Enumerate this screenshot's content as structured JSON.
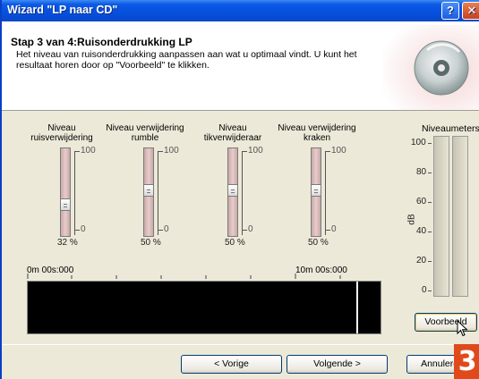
{
  "window": {
    "title": "Wizard \"LP naar CD\"",
    "help_glyph": "?",
    "close_glyph": "✕"
  },
  "header": {
    "step_title": "Stap 3 van 4:Ruisonderdrukking LP",
    "description": "Het niveau van ruisonderdrukking aanpassen aan wat u optimaal vindt. U kunt het resultaat horen door op \"Voorbeeld\" te klikken.",
    "icon": "cd-disc-icon"
  },
  "sliders": [
    {
      "label": "Niveau ruisverwijdering",
      "max": "100",
      "min": "0",
      "value_text": "32 %",
      "value": 32
    },
    {
      "label": "Niveau verwijdering rumble",
      "max": "100",
      "min": "0",
      "value_text": "50 %",
      "value": 50
    },
    {
      "label": "Niveau tikverwijderaar",
      "max": "100",
      "min": "0",
      "value_text": "50 %",
      "value": 50
    },
    {
      "label": "Niveau verwijdering kraken",
      "max": "100",
      "min": "0",
      "value_text": "50 %",
      "value": 50
    }
  ],
  "timeline": {
    "start_label": "0m 00s:000",
    "end_label": "10m 00s:000"
  },
  "meters": {
    "title": "Niveaumeters",
    "unit": "dB",
    "scale": [
      "100",
      "80",
      "60",
      "40",
      "20",
      "0"
    ]
  },
  "buttons": {
    "preview": "Voorbeeld",
    "previous": "< Vorige",
    "next": "Volgende >",
    "cancel": "Annuleren"
  },
  "badge": "3",
  "colors": {
    "title_bar": "#0550dd",
    "accent_badge": "#e04a1a",
    "dialog_bg": "#ece9d8",
    "outer_bg": "#f6d48a"
  }
}
